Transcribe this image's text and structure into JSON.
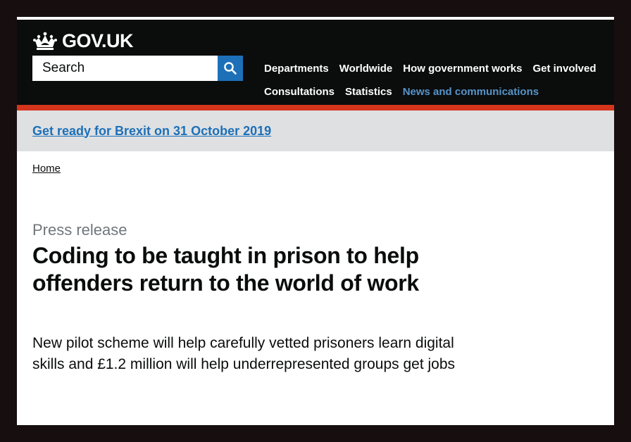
{
  "header": {
    "logo_text": "GOV.UK",
    "logo_icon": "crown-icon",
    "search": {
      "placeholder": "Search",
      "value": "",
      "button_icon": "search-icon"
    },
    "nav": {
      "row1": [
        "Departments",
        "Worldwide",
        "How government works",
        "Get involved"
      ],
      "row2": [
        "Consultations",
        "Statistics",
        "News and communications"
      ],
      "active": "News and communications"
    },
    "colors": {
      "background": "#0b0c0c",
      "accent_bar": "#d4351c",
      "search_button": "#1d70b8",
      "active_link": "#5694ca"
    }
  },
  "banner": {
    "link_text": "Get ready for Brexit on 31 October 2019",
    "background": "#dee0e2"
  },
  "breadcrumb": {
    "items": [
      "Home"
    ]
  },
  "article": {
    "caption": "Press release",
    "title": "Coding to be taught in prison to help offenders return to the world of work",
    "lead": "New pilot scheme will help carefully vetted prisoners learn digital skills and £1.2 million will help underrepresented groups get jobs"
  }
}
